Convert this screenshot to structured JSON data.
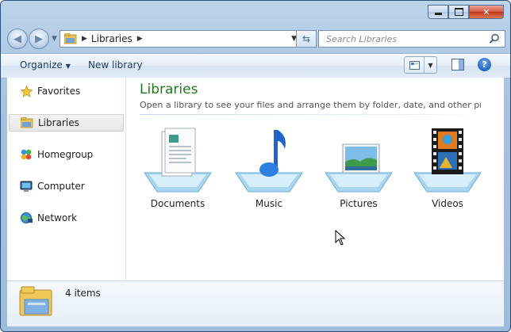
{
  "window": {
    "caption_buttons": {
      "minimize": "minimize-icon",
      "maximize": "maximize-icon",
      "close": "close-icon"
    }
  },
  "navigation": {
    "breadcrumb": [
      "Libraries"
    ],
    "search": {
      "placeholder": "Search Libraries"
    }
  },
  "toolbar": {
    "organize_label": "Organize",
    "new_library_label": "New library"
  },
  "sidebar": {
    "items": [
      {
        "label": "Favorites",
        "icon": "star-icon"
      },
      {
        "label": "Libraries",
        "icon": "libraries-icon",
        "selected": true
      },
      {
        "label": "Homegroup",
        "icon": "homegroup-icon"
      },
      {
        "label": "Computer",
        "icon": "computer-icon"
      },
      {
        "label": "Network",
        "icon": "network-icon"
      }
    ]
  },
  "main": {
    "title": "Libraries",
    "subtitle": "Open a library to see your files and arrange them by folder, date, and other properti...",
    "libraries": [
      {
        "label": "Documents",
        "icon": "documents-library-icon"
      },
      {
        "label": "Music",
        "icon": "music-library-icon"
      },
      {
        "label": "Pictures",
        "icon": "pictures-library-icon"
      },
      {
        "label": "Videos",
        "icon": "videos-library-icon"
      }
    ]
  },
  "status": {
    "item_count": "4 items"
  },
  "colors": {
    "title_green": "#1e7b1e",
    "frame_blue": "#a7c3e0",
    "close_red": "#c23516"
  }
}
